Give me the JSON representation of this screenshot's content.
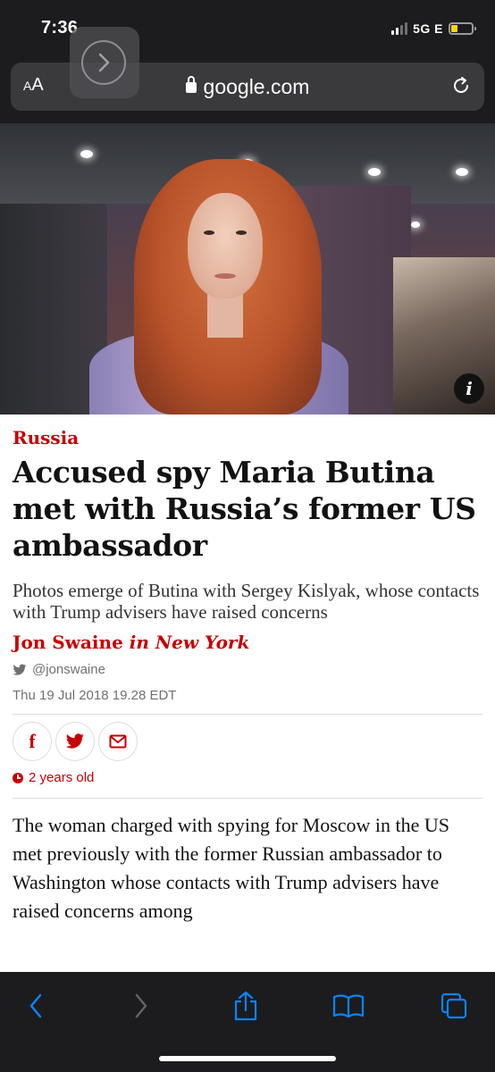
{
  "status": {
    "time": "7:36",
    "network": "5G E",
    "battery_level": 0.3
  },
  "browser": {
    "aa_label_small": "A",
    "aa_label_large": "A",
    "url": "google.com",
    "lock_icon": "lock-icon",
    "reload_icon": "reload-icon",
    "forward_overlay_icon": "chevron-right-icon"
  },
  "article": {
    "section": "Russia",
    "headline": "Accused spy Maria Butina met with Russia’s former US ambassador",
    "standfirst": "Photos emerge of Butina with Sergey Kislyak, whose contacts with Trump advisers have raised concerns",
    "author": "Jon Swaine",
    "location": "in New York",
    "twitter_handle": "@jonswaine",
    "date": "Thu 19 Jul 2018 19.28 EDT",
    "share": {
      "facebook_glyph": "f",
      "twitter_icon": "twitter-icon",
      "email_icon": "envelope-icon"
    },
    "age_label": "2 years old",
    "body": "The woman charged with spying for Moscow in the US met previously with the former Russian ambassador to Washington whose contacts with Trump advisers have raised concerns among",
    "image_info_glyph": "i"
  },
  "toolbar": {
    "back_icon": "chevron-left-icon",
    "forward_icon": "chevron-right-icon",
    "share_icon": "share-icon",
    "bookmarks_icon": "book-icon",
    "tabs_icon": "tabs-icon"
  },
  "colors": {
    "guardian_red": "#c70000",
    "ios_blue": "#0a84ff",
    "chrome_dark": "#1c1c1e"
  }
}
